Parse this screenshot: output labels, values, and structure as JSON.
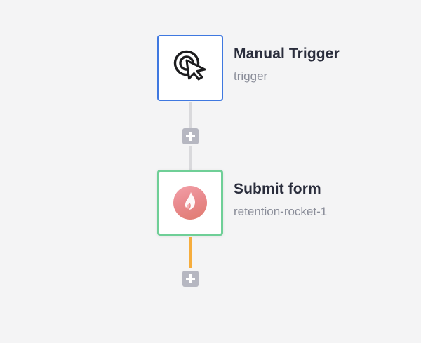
{
  "workflow": {
    "nodes": [
      {
        "title": "Manual Trigger",
        "subtitle": "trigger",
        "icon": "pointer-click-icon",
        "border_color": "#3f78e0"
      },
      {
        "title": "Submit form",
        "subtitle": "retention-rocket-1",
        "icon": "flame-logo-icon",
        "border_color": "#6fcf97"
      }
    ],
    "add_step_icon": "plus-icon",
    "connector_colors": {
      "default": "#d9d9dc",
      "active": "#f6ad3d"
    }
  }
}
